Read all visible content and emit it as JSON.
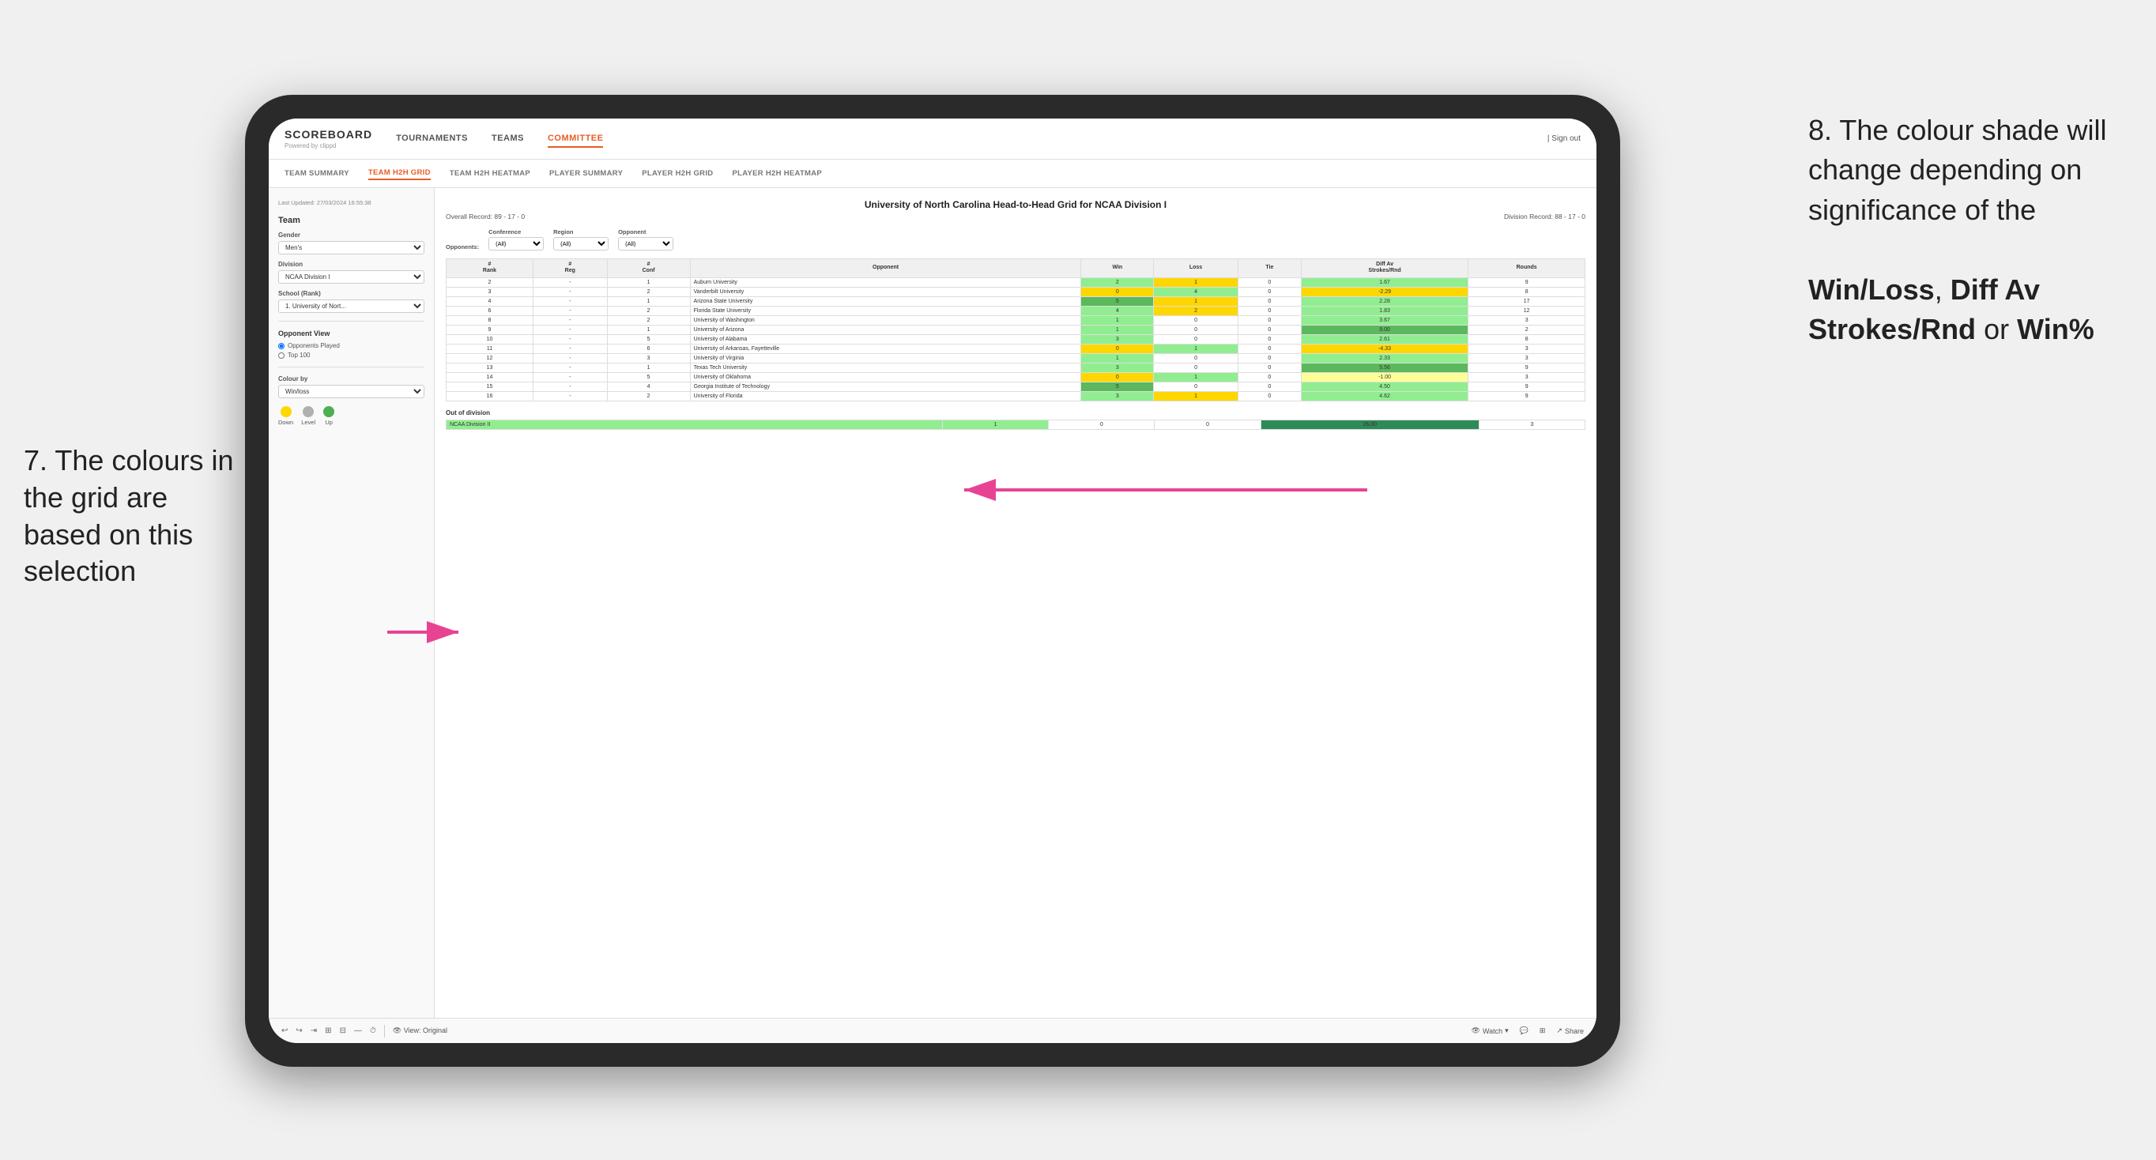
{
  "annotations": {
    "left_text": "7. The colours in the grid are based on this selection",
    "right_title": "8. The colour shade will change depending on significance of the",
    "right_bold1": "Win/Loss",
    "right_comma": ", ",
    "right_bold2": "Diff Av Strokes/Rnd",
    "right_or": " or ",
    "right_bold3": "Win%"
  },
  "nav": {
    "logo": "SCOREBOARD",
    "logo_sub": "Powered by clippd",
    "items": [
      "TOURNAMENTS",
      "TEAMS",
      "COMMITTEE"
    ],
    "sign_out": "Sign out"
  },
  "sub_nav": {
    "items": [
      "TEAM SUMMARY",
      "TEAM H2H GRID",
      "TEAM H2H HEATMAP",
      "PLAYER SUMMARY",
      "PLAYER H2H GRID",
      "PLAYER H2H HEATMAP"
    ],
    "active": "TEAM H2H GRID"
  },
  "sidebar": {
    "timestamp": "Last Updated: 27/03/2024 16:55:38",
    "team_section": "Team",
    "gender_label": "Gender",
    "gender_value": "Men's",
    "division_label": "Division",
    "division_value": "NCAA Division I",
    "school_label": "School (Rank)",
    "school_value": "1. University of Nort...",
    "opponent_view_title": "Opponent View",
    "radio1": "Opponents Played",
    "radio2": "Top 100",
    "colour_by_label": "Colour by",
    "colour_by_value": "Win/loss",
    "legend_down": "Down",
    "legend_level": "Level",
    "legend_up": "Up"
  },
  "grid": {
    "title": "University of North Carolina Head-to-Head Grid for NCAA Division I",
    "overall_record": "Overall Record: 89 - 17 - 0",
    "division_record": "Division Record: 88 - 17 - 0",
    "filters": {
      "conference_label": "Conference",
      "conference_value": "(All)",
      "region_label": "Region",
      "region_value": "(All)",
      "opponent_label": "Opponent",
      "opponent_value": "(All)",
      "opponents_label": "Opponents:"
    },
    "table_headers": [
      "# Rank",
      "# Reg",
      "# Conf",
      "Opponent",
      "Win",
      "Loss",
      "Tie",
      "Diff Av Strokes/Rnd",
      "Rounds"
    ],
    "rows": [
      {
        "rank": "2",
        "reg": "-",
        "conf": "1",
        "opponent": "Auburn University",
        "win": "2",
        "loss": "1",
        "tie": "0",
        "diff": "1.67",
        "rounds": "9"
      },
      {
        "rank": "3",
        "reg": "-",
        "conf": "2",
        "opponent": "Vanderbilt University",
        "win": "0",
        "loss": "4",
        "tie": "0",
        "diff": "-2.29",
        "rounds": "8"
      },
      {
        "rank": "4",
        "reg": "-",
        "conf": "1",
        "opponent": "Arizona State University",
        "win": "5",
        "loss": "1",
        "tie": "0",
        "diff": "2.28",
        "rounds": "17"
      },
      {
        "rank": "6",
        "reg": "-",
        "conf": "2",
        "opponent": "Florida State University",
        "win": "4",
        "loss": "2",
        "tie": "0",
        "diff": "1.83",
        "rounds": "12"
      },
      {
        "rank": "8",
        "reg": "-",
        "conf": "2",
        "opponent": "University of Washington",
        "win": "1",
        "loss": "0",
        "tie": "0",
        "diff": "3.67",
        "rounds": "3"
      },
      {
        "rank": "9",
        "reg": "-",
        "conf": "1",
        "opponent": "University of Arizona",
        "win": "1",
        "loss": "0",
        "tie": "0",
        "diff": "9.00",
        "rounds": "2"
      },
      {
        "rank": "10",
        "reg": "-",
        "conf": "5",
        "opponent": "University of Alabama",
        "win": "3",
        "loss": "0",
        "tie": "0",
        "diff": "2.61",
        "rounds": "8"
      },
      {
        "rank": "11",
        "reg": "-",
        "conf": "6",
        "opponent": "University of Arkansas, Fayetteville",
        "win": "0",
        "loss": "1",
        "tie": "0",
        "diff": "-4.33",
        "rounds": "3"
      },
      {
        "rank": "12",
        "reg": "-",
        "conf": "3",
        "opponent": "University of Virginia",
        "win": "1",
        "loss": "0",
        "tie": "0",
        "diff": "2.33",
        "rounds": "3"
      },
      {
        "rank": "13",
        "reg": "-",
        "conf": "1",
        "opponent": "Texas Tech University",
        "win": "3",
        "loss": "0",
        "tie": "0",
        "diff": "5.56",
        "rounds": "9"
      },
      {
        "rank": "14",
        "reg": "-",
        "conf": "5",
        "opponent": "University of Oklahoma",
        "win": "0",
        "loss": "1",
        "tie": "0",
        "diff": "-1.00",
        "rounds": "3"
      },
      {
        "rank": "15",
        "reg": "-",
        "conf": "4",
        "opponent": "Georgia Institute of Technology",
        "win": "5",
        "loss": "0",
        "tie": "0",
        "diff": "4.50",
        "rounds": "9"
      },
      {
        "rank": "16",
        "reg": "-",
        "conf": "2",
        "opponent": "University of Florida",
        "win": "3",
        "loss": "1",
        "tie": "0",
        "diff": "4.62",
        "rounds": "9"
      }
    ],
    "out_of_division_header": "Out of division",
    "out_rows": [
      {
        "division": "NCAA Division II",
        "win": "1",
        "loss": "0",
        "tie": "0",
        "diff": "26.00",
        "rounds": "3"
      }
    ]
  },
  "toolbar": {
    "view_label": "View: Original",
    "watch_label": "Watch",
    "share_label": "Share"
  },
  "colors": {
    "accent": "#e85d26",
    "green_dark": "#2e8b57",
    "green_med": "#5cb85c",
    "green_light": "#90ee90",
    "yellow": "#ffff99",
    "orange": "#ffa500",
    "red": "#ff6347"
  }
}
